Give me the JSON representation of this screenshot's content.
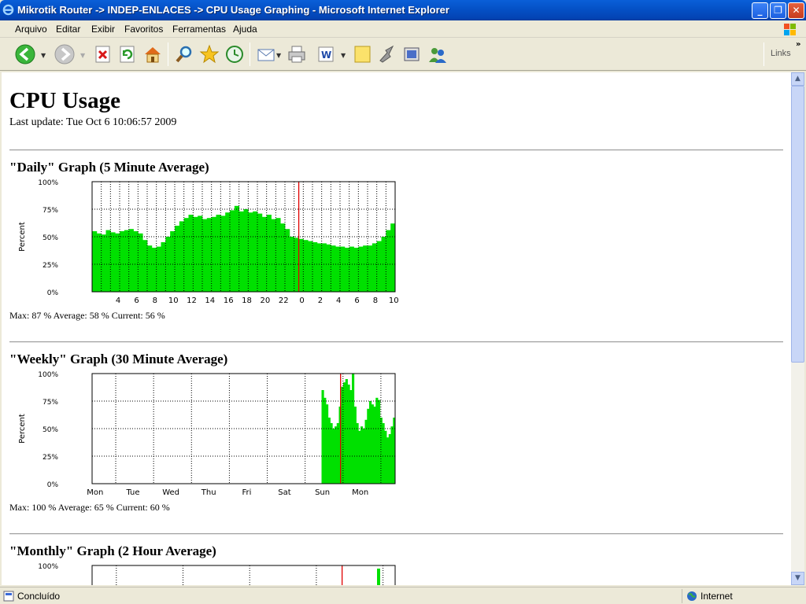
{
  "window": {
    "title": "Mikrotik Router -> INDEP-ENLACES -> CPU Usage Graphing - Microsoft Internet Explorer"
  },
  "menu": [
    "Arquivo",
    "Editar",
    "Exibir",
    "Favoritos",
    "Ferramentas",
    "Ajuda"
  ],
  "toolbar": {
    "links_label": "Links"
  },
  "page": {
    "title": "CPU Usage",
    "last_update": "Last update: Tue Oct 6 10:06:57 2009"
  },
  "graphs": [
    {
      "title": "\"Daily\" Graph (5 Minute Average)",
      "stats": "Max: 87 %  Average: 58 %  Current: 56 %"
    },
    {
      "title": "\"Weekly\" Graph (30 Minute Average)",
      "stats": "Max: 100 %  Average: 65 %  Current: 60 %"
    },
    {
      "title": "\"Monthly\" Graph (2 Hour Average)"
    }
  ],
  "status": {
    "left": "Concluído",
    "zone": "Internet"
  },
  "colors": {
    "fill": "#00e000",
    "now_line": "#e00000",
    "title_bar": "#0552c8"
  },
  "chart_data": [
    {
      "type": "area",
      "title": "\"Daily\" Graph (5 Minute Average)",
      "ylabel": "Percent",
      "yticks": [
        "100%",
        "75%",
        "50%",
        "25%",
        "0%"
      ],
      "ylim": [
        0,
        100
      ],
      "xticks": [
        "4",
        "6",
        "8",
        "10",
        "12",
        "14",
        "16",
        "18",
        "20",
        "22",
        "0",
        "2",
        "4",
        "6",
        "8",
        "10"
      ],
      "grid": true,
      "series": [
        {
          "values": [
            55,
            53,
            52,
            56,
            54,
            53,
            55,
            56,
            57,
            55,
            53,
            47,
            42,
            40,
            41,
            45,
            50,
            55,
            60,
            64,
            67,
            70,
            68,
            69,
            66,
            67,
            68,
            70,
            69,
            72,
            74,
            78,
            73,
            75,
            72,
            73,
            71,
            68,
            70,
            66,
            67,
            62,
            57,
            50,
            49,
            48,
            47,
            46,
            45,
            44,
            44,
            43,
            42,
            41,
            41,
            40,
            41,
            40,
            41,
            42,
            42,
            44,
            46,
            50,
            56,
            62
          ]
        }
      ]
    },
    {
      "type": "area",
      "title": "\"Weekly\" Graph (30 Minute Average)",
      "ylabel": "Percent",
      "yticks": [
        "100%",
        "75%",
        "50%",
        "25%",
        "0%"
      ],
      "ylim": [
        0,
        100
      ],
      "xticks": [
        "Mon",
        "Tue",
        "Wed",
        "Thu",
        "Fri",
        "Sat",
        "Sun",
        "Mon"
      ],
      "grid": true,
      "series": [
        {
          "values": [
            0,
            0,
            0,
            0,
            0,
            0,
            0,
            0,
            0,
            0,
            0,
            0,
            0,
            0,
            0,
            0,
            0,
            0,
            0,
            0,
            0,
            0,
            0,
            0,
            0,
            0,
            0,
            0,
            0,
            0,
            0,
            0,
            0,
            0,
            0,
            0,
            0,
            0,
            0,
            0,
            0,
            0,
            0,
            0,
            0,
            0,
            0,
            0,
            0,
            0,
            0,
            0,
            0,
            0,
            0,
            0,
            0,
            0,
            0,
            0,
            0,
            0,
            0,
            0,
            0,
            0,
            0,
            0,
            0,
            0,
            0,
            0,
            0,
            0,
            0,
            0,
            0,
            0,
            0,
            0,
            0,
            0,
            0,
            0,
            0,
            0,
            0,
            0,
            0,
            0,
            0,
            0,
            0,
            0,
            0,
            0,
            0,
            0,
            0,
            0,
            0,
            0,
            0,
            0,
            0,
            0,
            85,
            78,
            72,
            60,
            55,
            50,
            52,
            55,
            70,
            88,
            92,
            95,
            90,
            85,
            100,
            70,
            55,
            48,
            52,
            50,
            58,
            68,
            75,
            72,
            70,
            78,
            76,
            60,
            55,
            48,
            42,
            45,
            52,
            60
          ]
        }
      ]
    },
    {
      "type": "area",
      "title": "\"Monthly\" Graph (2 Hour Average)",
      "yticks": [
        "100%"
      ],
      "ylim": [
        0,
        100
      ],
      "grid": true,
      "series": [
        {
          "values": []
        }
      ]
    }
  ]
}
